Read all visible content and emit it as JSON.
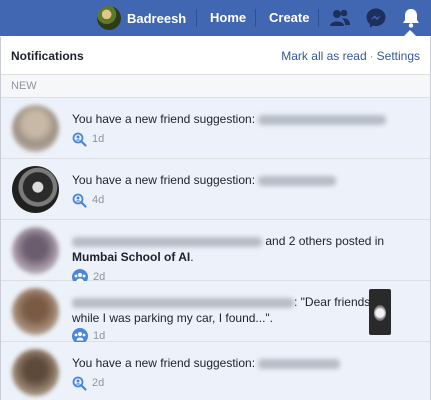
{
  "topbar": {
    "user_name": "Badreesh",
    "home_label": "Home",
    "create_label": "Create"
  },
  "panel": {
    "title": "Notifications",
    "mark_all_read": "Mark all as read",
    "separator": "·",
    "settings": "Settings",
    "section_new": "NEW"
  },
  "notifications": [
    {
      "text": "You have a new friend suggestion:",
      "time": "1d",
      "icon": "friend-suggestion-icon"
    },
    {
      "text": "You have a new friend suggestion:",
      "time": "4d",
      "icon": "friend-suggestion-icon"
    },
    {
      "text_mid": "and 2 others posted in",
      "group": "Mumbai School of AI",
      "text_end": ".",
      "time": "2d",
      "icon": "group-icon"
    },
    {
      "text": ": \"Dear friends, while I was parking my car, I found...\".",
      "time": "1d",
      "icon": "group-icon"
    },
    {
      "text": "You have a new friend suggestion:",
      "time": "2d",
      "icon": "friend-suggestion-icon"
    }
  ],
  "colors": {
    "brand_blue": "#4267b2",
    "unread_bg": "#edf2fa",
    "link_blue": "#365899"
  }
}
